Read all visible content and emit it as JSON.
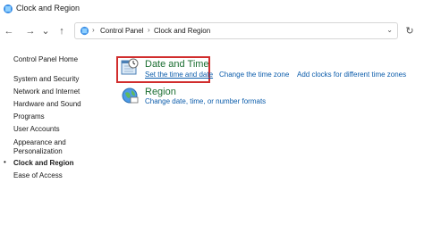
{
  "window": {
    "title": "Clock and Region"
  },
  "nav": {
    "back": "←",
    "forward": "→",
    "dropdown": "⌄",
    "up": "↑",
    "refresh": "↻",
    "breadcrumb": [
      "Control Panel",
      "Clock and Region"
    ],
    "separator": "›",
    "address_dropdown": "⌄"
  },
  "sidebar": {
    "bullet": "•",
    "items": [
      {
        "label": "Control Panel Home"
      },
      {
        "label": "System and Security"
      },
      {
        "label": "Network and Internet"
      },
      {
        "label": "Hardware and Sound"
      },
      {
        "label": "Programs"
      },
      {
        "label": "User Accounts"
      },
      {
        "label": "Appearance and"
      },
      {
        "label": "Personalization"
      },
      {
        "label": "Clock and Region"
      },
      {
        "label": "Ease of Access"
      }
    ]
  },
  "categories": [
    {
      "title": "Date and Time",
      "icon": "clock-calendar-icon",
      "links": [
        "Set the time and date",
        "Change the time zone",
        "Add clocks for different time zones"
      ]
    },
    {
      "title": "Region",
      "icon": "globe-region-icon",
      "links": [
        "Change date, time, or number formats"
      ]
    }
  ],
  "colors": {
    "highlight_border": "#d12d2d",
    "category_title": "#1b6e31",
    "link": "#0b5cab"
  }
}
